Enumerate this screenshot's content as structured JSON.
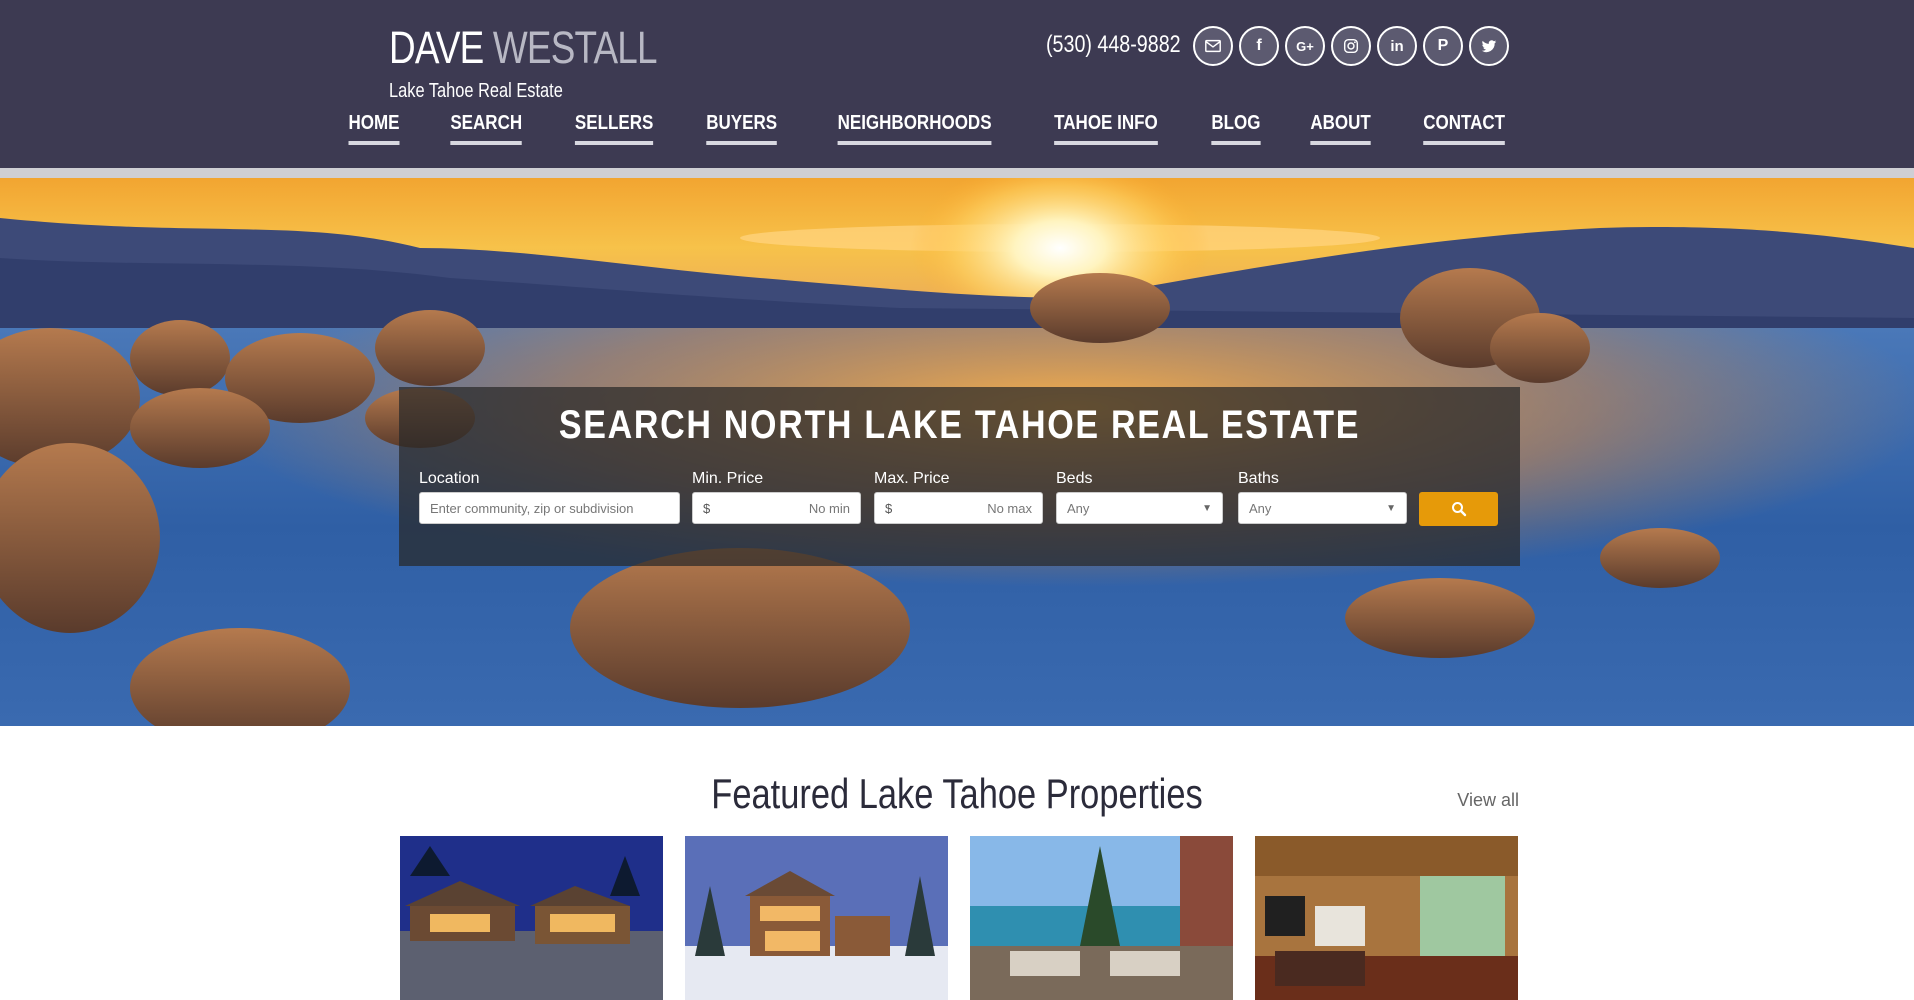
{
  "header": {
    "brand_first": "DAVE",
    "brand_last": "WESTALL",
    "tagline": "Lake Tahoe Real Estate",
    "phone": "(530) 448-9882",
    "social": [
      "email-icon",
      "facebook-icon",
      "google-plus-icon",
      "instagram-icon",
      "linkedin-icon",
      "pinterest-icon",
      "twitter-icon"
    ],
    "social_glyphs": {
      "facebook": "f",
      "googleplus": "G+",
      "linkedin": "in",
      "pinterest": "P"
    },
    "nav": [
      "HOME",
      "SEARCH",
      "SELLERS",
      "BUYERS",
      "NEIGHBORHOODS",
      "TAHOE INFO",
      "BLOG",
      "ABOUT",
      "CONTACT"
    ],
    "colors": {
      "header_bg": "#3d3a52",
      "accent": "#e69a09"
    }
  },
  "search": {
    "title": "SEARCH NORTH LAKE TAHOE REAL ESTATE",
    "location_label": "Location",
    "location_placeholder": "Enter community, zip or subdivision",
    "min_label": "Min. Price",
    "min_currency": "$",
    "min_value": "No min",
    "max_label": "Max. Price",
    "max_currency": "$",
    "max_value": "No max",
    "beds_label": "Beds",
    "beds_value": "Any",
    "baths_label": "Baths",
    "baths_value": "Any",
    "button_icon": "search-icon"
  },
  "featured": {
    "title": "Featured Lake Tahoe Properties",
    "view_all": "View all"
  }
}
